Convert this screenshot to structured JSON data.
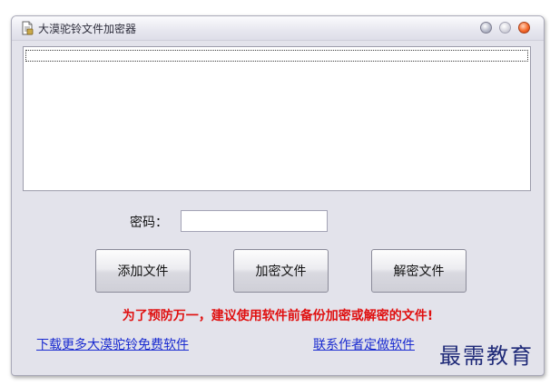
{
  "window": {
    "title": "大漠驼铃文件加密器"
  },
  "form": {
    "password_label": "密码：",
    "password_value": ""
  },
  "buttons": {
    "add_file": "添加文件",
    "encrypt_file": "加密文件",
    "decrypt_file": "解密文件"
  },
  "notice": {
    "warning": "为了预防万一，建议使用软件前备份加密或解密的文件!"
  },
  "links": {
    "download_more": "下载更多大漠驼铃免费软件",
    "contact_author": "联系作者定做软件"
  },
  "watermark": {
    "text": "最需教育"
  },
  "colors": {
    "warning_text": "#e01010",
    "link_text": "#1a2bd0",
    "close_button": "#f56a2c"
  }
}
